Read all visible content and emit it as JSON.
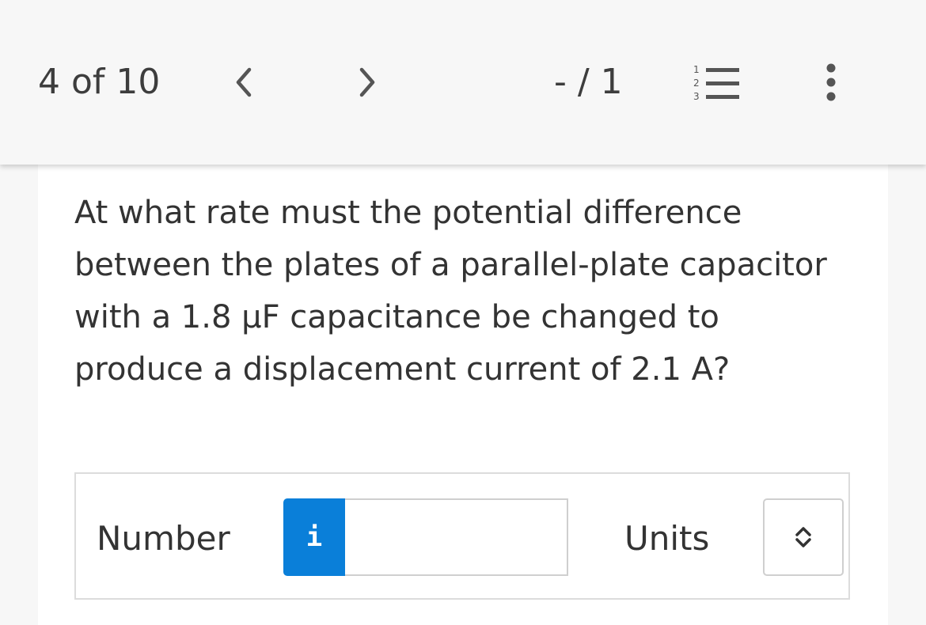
{
  "header": {
    "counter": "4 of 10",
    "score": "- / 1",
    "prev_icon": "chevron-left-icon",
    "next_icon": "chevron-right-icon",
    "list_icon": "numbered-list-icon",
    "more_icon": "more-vertical-icon",
    "list_digits": [
      "1",
      "2",
      "3"
    ]
  },
  "question": {
    "text": "At what rate must the potential difference between the plates of a parallel-plate capacitor with a 1.8 μF capacitance be changed to produce a displacement current of 2.1 A?"
  },
  "answer": {
    "number_label": "Number",
    "info_glyph": "i",
    "number_value": "",
    "units_label": "Units",
    "units_selected": ""
  },
  "colors": {
    "accent": "#0a7fd9",
    "text": "#333333",
    "background": "#f7f7f7"
  }
}
